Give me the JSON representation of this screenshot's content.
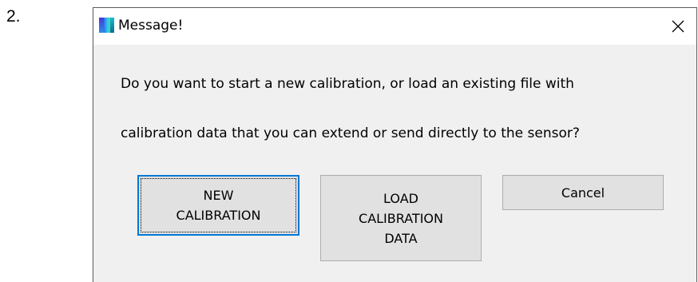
{
  "step": {
    "number": "2."
  },
  "window": {
    "title": "Message!",
    "icon": "app-icon",
    "close_icon": "close-icon"
  },
  "message": {
    "line1": "Do you want to start a new calibration, or load an existing file with",
    "line2": "calibration data that you can extend or send directly to the sensor?"
  },
  "buttons": {
    "new_calibration": "NEW\nCALIBRATION",
    "load_calibration_data": "LOAD\nCALIBRATION\nDATA",
    "cancel": "Cancel"
  },
  "colors": {
    "dialog_background": "#f0f0f0",
    "button_background": "#e1e1e1",
    "focus_border": "#0078d7"
  }
}
